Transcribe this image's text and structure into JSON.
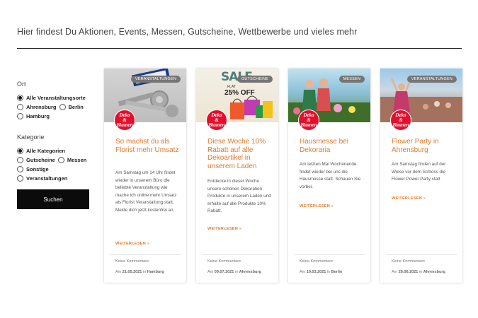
{
  "header": {
    "headline": "Hier findest Du Aktionen, Events, Messen, Gutscheine, Wettbewerbe und vieles mehr"
  },
  "filter": {
    "ort_title": "Ort",
    "ort_options": [
      "Alle Veranstaltungsorte",
      "Ahrensburg",
      "Berlin",
      "Hamburg"
    ],
    "ort_selected": "Alle Veranstaltungsorte",
    "kategorie_title": "Kategorie",
    "kategorie_options": [
      "Alle Kategorien",
      "Gutscheine",
      "Messen",
      "Sonstige",
      "Veranstaltungen"
    ],
    "kategorie_selected": "Alle Kategorien",
    "search_label": "Suchen"
  },
  "logo": {
    "line1": "Deko",
    "line2": "&",
    "line3": "Blumen"
  },
  "cards": [
    {
      "category": "VERANSTALTUNGEN",
      "title": "So machst du als Florist mehr Umsatz",
      "excerpt": "Am Samstag um 14 Uhr findet wieder in unserem Büro die beliebte Veranstaltung wie mache ich online mehr Umsatz als Florist Veranstaltung statt. Melde dich jetzt kostenfrei an.",
      "more": "WEITERLESEN »",
      "comments": "Keine Kommentare",
      "date_prefix": "Am",
      "date": "21.05.2021",
      "in": "in",
      "location": "Hamburg"
    },
    {
      "category": "GUTSCHEINE",
      "title": "Diese Woche 10% Rabatt auf alle Dekoartikel in unserem Laden",
      "excerpt": "Entdecke in dieser Woche unsere schönen Dekoration Produkte in unserem Laden und erhalte auf alle Produkte 10% Rabatt.",
      "more": "WEITERLESEN »",
      "comments": "Keine Kommentare",
      "date_prefix": "Am",
      "date": "09.07.2021",
      "in": "in",
      "location": "Ahrensburg",
      "sale_text": "SALE",
      "flat_text": "FLAT",
      "percent_text": "25% OFF"
    },
    {
      "category": "MESSEN",
      "title": "Hausmesse bei Dekoraria",
      "excerpt": "Am letzten Mai Wochenende findet wieder bei uns die Hausmesse statt. Schauen Sie vorbei.",
      "more": "WEITERLESEN »",
      "comments": "Keine Kommentare",
      "date_prefix": "Am",
      "date": "19.03.2021",
      "in": "in",
      "location": "Berlin"
    },
    {
      "category": "VERANSTALTUNGEN",
      "title": "Flower Party in Ahrensburg",
      "excerpt": "Am Samstag finden auf der Wiese vor dem Schloss die Flower Power Party statt",
      "more": "WEITERLESEN »",
      "comments": "Keine Kommentare",
      "date_prefix": "Am",
      "date": "26.06.2021",
      "in": "in",
      "location": "Ahrensburg"
    }
  ]
}
